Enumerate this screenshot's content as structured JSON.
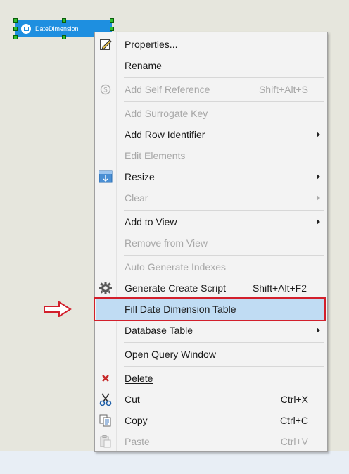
{
  "canvas": {
    "entity_label": "DateDimension"
  },
  "menu": {
    "items": [
      {
        "label": "Properties...",
        "shortcut": "",
        "icon": "edit-pencil-icon",
        "enabled": true,
        "submenu": false
      },
      {
        "label": "Rename",
        "shortcut": "",
        "icon": "",
        "enabled": true,
        "submenu": false
      },
      {
        "label": "Add Self Reference",
        "shortcut": "Shift+Alt+S",
        "icon": "self-reference-icon",
        "enabled": false,
        "submenu": false
      },
      {
        "label": "Add Surrogate Key",
        "shortcut": "",
        "icon": "",
        "enabled": false,
        "submenu": false
      },
      {
        "label": "Add Row Identifier",
        "shortcut": "",
        "icon": "",
        "enabled": true,
        "submenu": true
      },
      {
        "label": "Edit Elements",
        "shortcut": "",
        "icon": "",
        "enabled": false,
        "submenu": false
      },
      {
        "label": "Resize",
        "shortcut": "",
        "icon": "resize-icon",
        "enabled": true,
        "submenu": true
      },
      {
        "label": "Clear",
        "shortcut": "",
        "icon": "",
        "enabled": false,
        "submenu": true
      },
      {
        "label": "Add to View",
        "shortcut": "",
        "icon": "",
        "enabled": true,
        "submenu": true
      },
      {
        "label": "Remove from View",
        "shortcut": "",
        "icon": "",
        "enabled": false,
        "submenu": false
      },
      {
        "label": "Auto Generate Indexes",
        "shortcut": "",
        "icon": "",
        "enabled": false,
        "submenu": false
      },
      {
        "label": "Generate Create Script",
        "shortcut": "Shift+Alt+F2",
        "icon": "gear-icon",
        "enabled": true,
        "submenu": false
      },
      {
        "label": "Fill Date Dimension Table",
        "shortcut": "",
        "icon": "",
        "enabled": true,
        "submenu": false,
        "highlighted": true
      },
      {
        "label": "Database Table",
        "shortcut": "",
        "icon": "",
        "enabled": true,
        "submenu": true
      },
      {
        "label": "Open Query Window",
        "shortcut": "",
        "icon": "",
        "enabled": true,
        "submenu": false
      },
      {
        "label": "Delete",
        "shortcut": "",
        "icon": "delete-x-icon",
        "enabled": true,
        "submenu": false
      },
      {
        "label": "Cut",
        "shortcut": "Ctrl+X",
        "icon": "scissors-icon",
        "enabled": true,
        "submenu": false
      },
      {
        "label": "Copy",
        "shortcut": "Ctrl+C",
        "icon": "copy-icon",
        "enabled": true,
        "submenu": false
      },
      {
        "label": "Paste",
        "shortcut": "Ctrl+V",
        "icon": "paste-icon",
        "enabled": false,
        "submenu": false
      }
    ]
  },
  "colors": {
    "highlight_bg": "#c0dcf3",
    "annotation_red": "#d21f2b",
    "entity_blue": "#1e8fe0"
  }
}
